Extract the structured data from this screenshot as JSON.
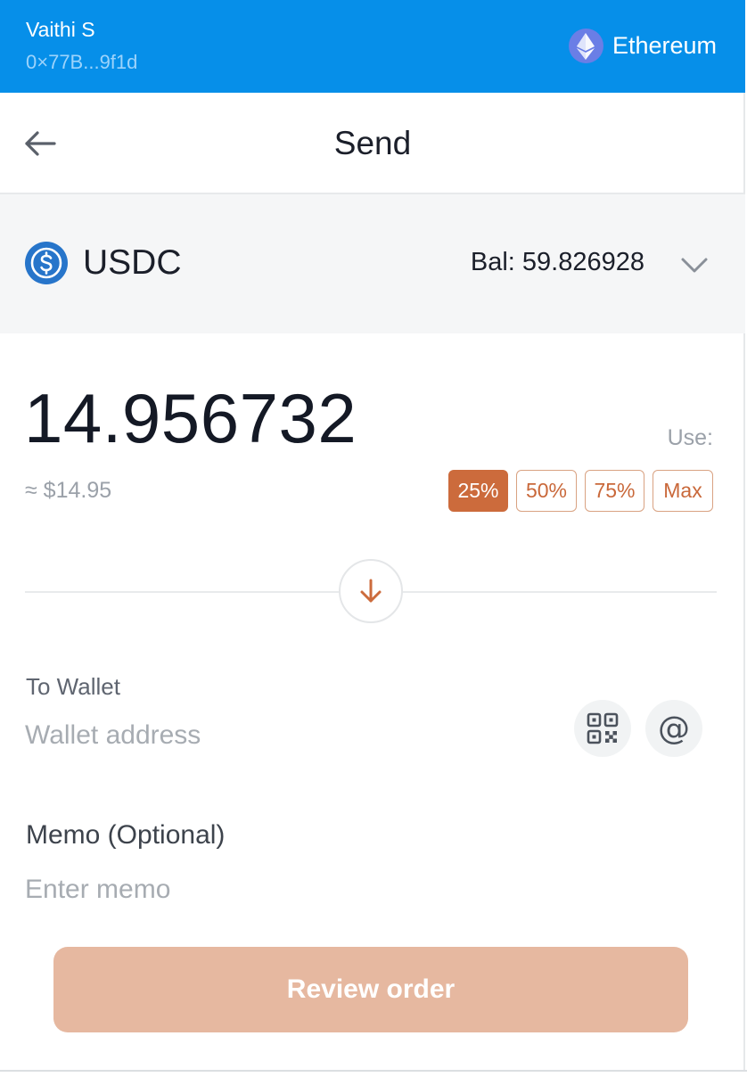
{
  "header": {
    "user_name": "Vaithi S",
    "wallet_address_short": "0×77B...9f1d",
    "network": "Ethereum",
    "network_icon": "ethereum-icon",
    "background_color": "#068fe9"
  },
  "titlebar": {
    "back_icon": "arrow-left-icon",
    "title": "Send"
  },
  "token": {
    "icon": "usdc-icon",
    "symbol": "USDC",
    "balance_text": "Bal: 59.826928",
    "dropdown_icon": "chevron-down-icon"
  },
  "amount": {
    "value": "14.956732",
    "fiat_estimate": "≈ $14.95",
    "use_label": "Use:",
    "presets": [
      {
        "label": "25%",
        "active": true
      },
      {
        "label": "50%",
        "active": false
      },
      {
        "label": "75%",
        "active": false
      },
      {
        "label": "Max",
        "active": false
      }
    ],
    "accent_color": "#cc6b3c"
  },
  "swap_icon": "arrow-down-icon",
  "wallet": {
    "label": "To Wallet",
    "placeholder": "Wallet address",
    "value": "",
    "qr_icon": "qr-code-icon",
    "at_icon": "at-sign-icon",
    "at_glyph": "@"
  },
  "memo": {
    "label": "Memo (Optional)",
    "placeholder": "Enter memo",
    "value": ""
  },
  "review": {
    "label": "Review order",
    "disabled_color": "#e6b8a0"
  }
}
